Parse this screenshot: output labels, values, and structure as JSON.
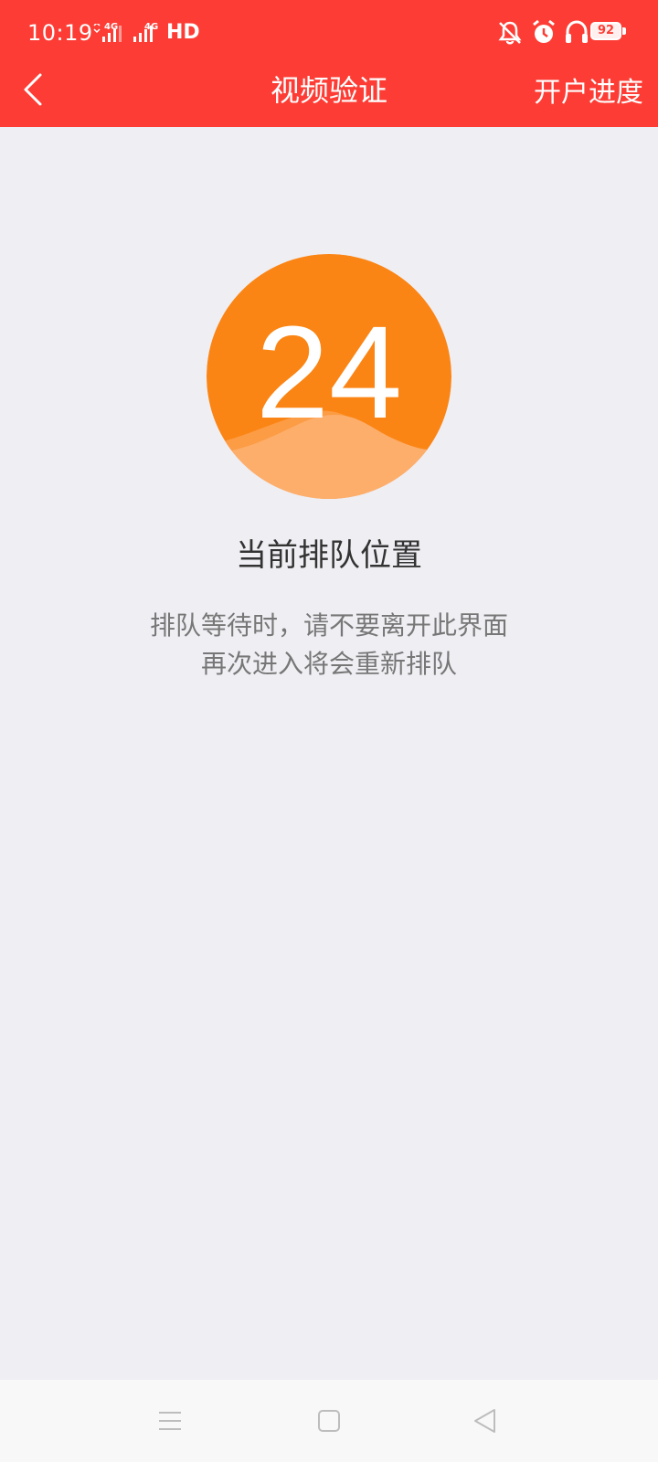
{
  "status_bar": {
    "time": "10:19",
    "network_1": "4G",
    "network_2": "4G",
    "hd": "HD",
    "battery": "92",
    "icons": [
      "mute-icon",
      "alarm-icon",
      "headset-icon",
      "battery-icon"
    ]
  },
  "header": {
    "back_icon": "chevron-left-icon",
    "title": "视频验证",
    "action": "开户进度"
  },
  "queue": {
    "position": "24",
    "label": "当前排队位置",
    "tip_line1": "排队等待时，请不要离开此界面",
    "tip_line2": "再次进入将会重新排队"
  },
  "nav_bar": {
    "icons": [
      "menu-icon",
      "home-icon",
      "back-icon"
    ]
  },
  "colors": {
    "header_bg": "#fd3d35",
    "circle": "#fb8514",
    "wave": "#fdae6b",
    "background": "#efeef3"
  }
}
